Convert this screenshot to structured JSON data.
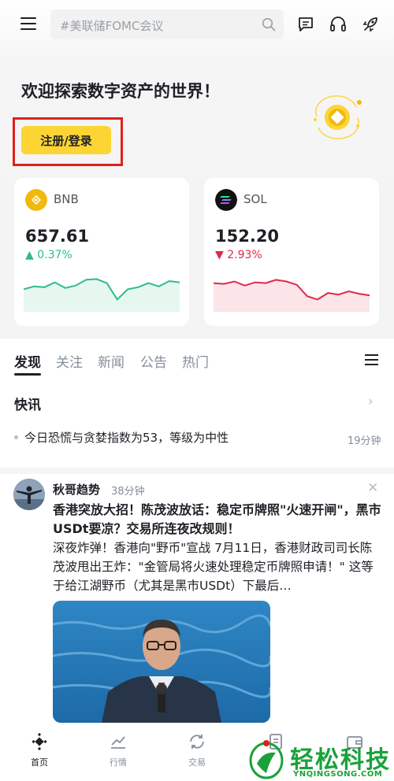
{
  "search": {
    "placeholder": "#美联储FOMC会议"
  },
  "hero": {
    "welcome": "欢迎探索数字资产的世界！",
    "login_button": "注册/登录"
  },
  "markets": [
    {
      "symbol": "BNB",
      "price": "657.61",
      "change": "▲ 0.37%",
      "direction": "up",
      "spark": [
        0.55,
        0.62,
        0.6,
        0.72,
        0.58,
        0.64,
        0.78,
        0.8,
        0.7,
        0.3,
        0.55,
        0.6,
        0.7,
        0.62,
        0.75,
        0.72
      ]
    },
    {
      "symbol": "SOL",
      "price": "152.20",
      "change": "▼ 2.93%",
      "direction": "down",
      "spark": [
        0.7,
        0.68,
        0.74,
        0.64,
        0.72,
        0.7,
        0.78,
        0.74,
        0.66,
        0.38,
        0.3,
        0.46,
        0.42,
        0.5,
        0.44,
        0.4
      ]
    }
  ],
  "tabs": [
    "发现",
    "关注",
    "新闻",
    "公告",
    "热门"
  ],
  "flash": {
    "title": "快讯",
    "item_text": "今日恐慌与贪婪指数为53，等级为中性",
    "item_time": "19分钟"
  },
  "post": {
    "author": "秋哥趋势",
    "time": "38分钟",
    "title": "香港突放大招！陈茂波放话：稳定币牌照\"火速开闸\"，黑市USDt要凉？交易所连夜改规则！",
    "body": "深夜炸弹！香港向\"野币\"宣战 7月11日，香港财政司司长陈茂波甩出王炸：\"金管局将火速处理稳定币牌照申请！\" 这等于给江湖野币（尤其是黑市USDt）下最后…"
  },
  "bottom_nav": [
    {
      "label": "首页",
      "icon": "home-icon"
    },
    {
      "label": "行情",
      "icon": "markets-icon"
    },
    {
      "label": "交易",
      "icon": "trade-icon"
    },
    {
      "label": "",
      "icon": "futures-icon"
    },
    {
      "label": "",
      "icon": "wallet-icon"
    }
  ],
  "watermark": {
    "text": "轻松科技",
    "sub": "YNQINGSONG.COM"
  },
  "colors": {
    "accent": "#fcd535",
    "up": "#2ebd85",
    "down": "#e0294a",
    "highlight_box": "#e0201b"
  }
}
